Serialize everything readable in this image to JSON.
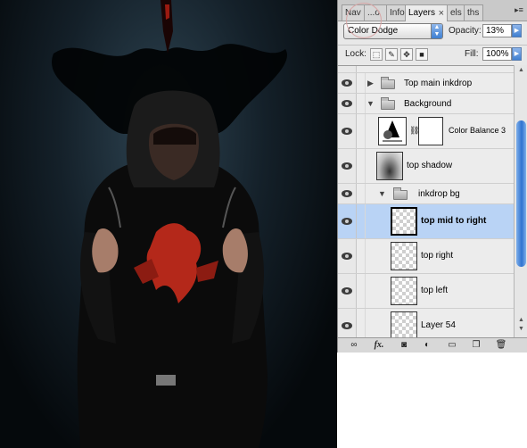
{
  "tabs": [
    {
      "label": "Nav"
    },
    {
      "label": "...o"
    },
    {
      "label": "Info"
    },
    {
      "label": "Layers",
      "close": "×"
    },
    {
      "label": "els"
    },
    {
      "label": "ths"
    }
  ],
  "panel_menu": "▸≡",
  "blend_mode": {
    "value": "Color Dodge"
  },
  "opacity": {
    "label": "Opacity:",
    "value": "13%"
  },
  "lock": {
    "label": "Lock:"
  },
  "fill": {
    "label": "Fill:",
    "value": "100%"
  },
  "layers": [
    {
      "name": "Top main inkdrop",
      "kind": "group",
      "expanded": false
    },
    {
      "name": "Background",
      "kind": "group",
      "expanded": true
    },
    {
      "name": "Color Balance 3",
      "kind": "adjustment"
    },
    {
      "name": "top shadow",
      "kind": "layer"
    },
    {
      "name": "inkdrop bg",
      "kind": "group",
      "expanded": true
    },
    {
      "name": "top mid to right",
      "kind": "layer",
      "selected": true
    },
    {
      "name": "top right",
      "kind": "layer"
    },
    {
      "name": "top left",
      "kind": "layer"
    },
    {
      "name": "Layer 54",
      "kind": "layer"
    }
  ],
  "toolbar_icons": [
    "link-icon",
    "fx-icon",
    "mask-icon",
    "adjustment-icon",
    "folder-icon",
    "new-layer-icon",
    "trash-icon"
  ],
  "toolbar_fx": "fx.",
  "colors": {
    "selected": "#b9d3f5",
    "accent": "#3f7fd1",
    "ink_red": "#b4281a"
  }
}
